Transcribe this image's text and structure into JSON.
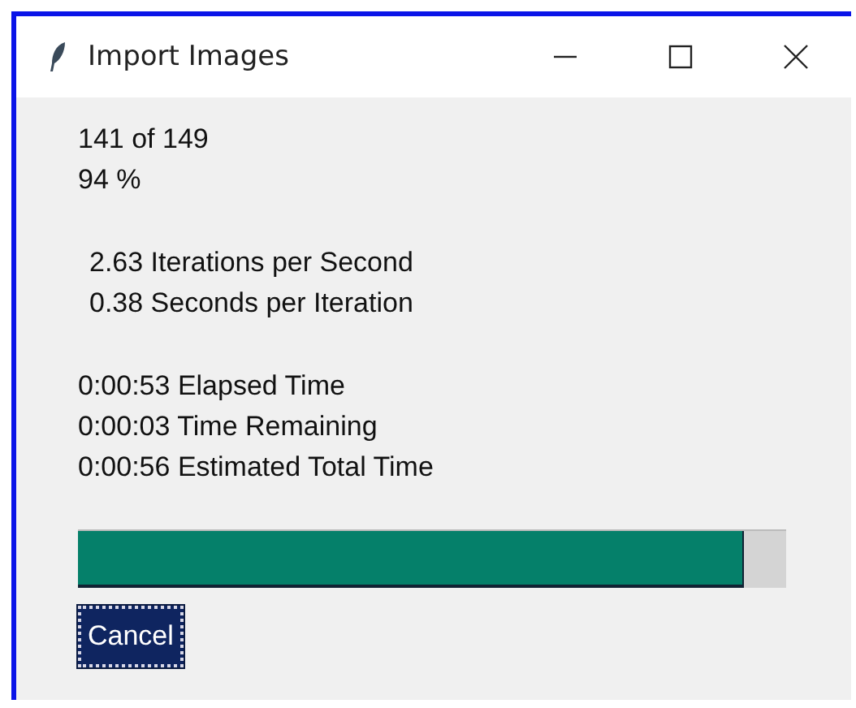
{
  "window": {
    "title": "Import Images"
  },
  "progress_lines": [
    {
      "text": "141 of 149"
    },
    {
      "text": "94 %"
    }
  ],
  "rate_lines": [
    {
      "text": "2.63 Iterations per Second"
    },
    {
      "text": "0.38 Seconds per Iteration"
    }
  ],
  "time_lines": [
    {
      "text": "0:00:53 Elapsed Time"
    },
    {
      "text": "0:00:03 Time Remaining"
    },
    {
      "text": "0:00:56 Estimated Total Time"
    }
  ],
  "progress_bar": {
    "level": 0.94
  },
  "buttons": [
    {
      "label": "Cancel"
    }
  ]
}
